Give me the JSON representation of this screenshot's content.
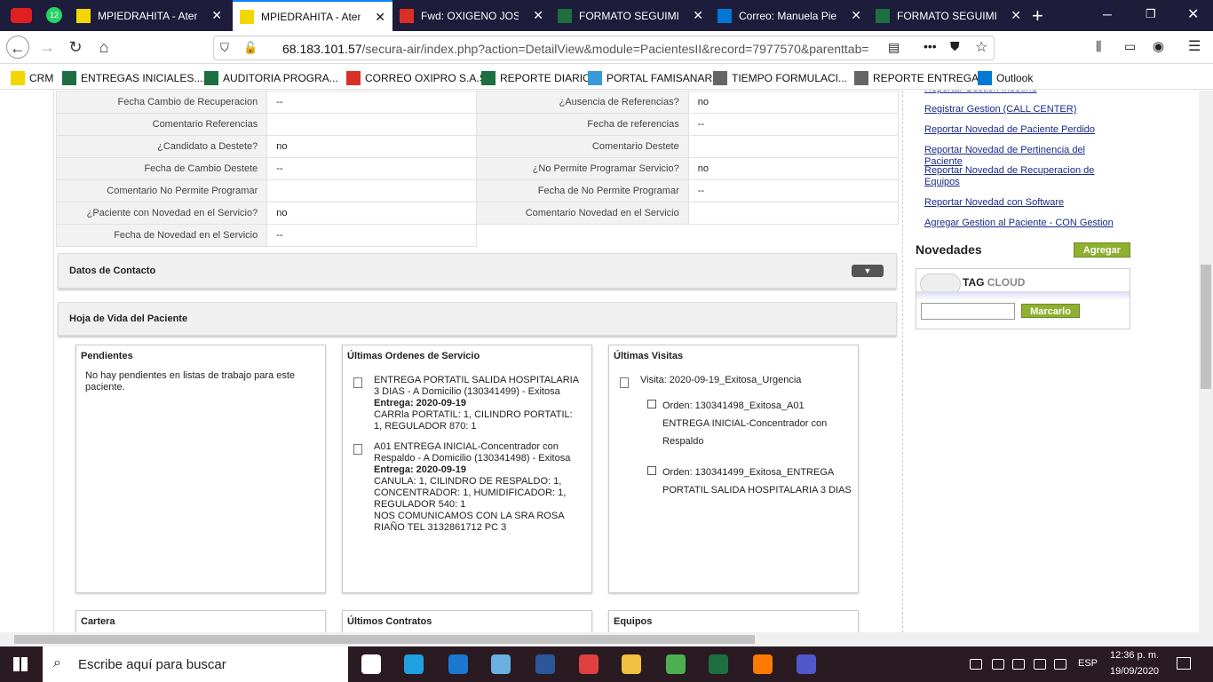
{
  "tabs": [
    {
      "title": "MPIEDRAHITA - Atenc",
      "active": false
    },
    {
      "title": "MPIEDRAHITA - Atenc",
      "active": true
    },
    {
      "title": "Fwd: OXIGENO JOSE P",
      "active": false
    },
    {
      "title": "FORMATO SEGUIMIEN",
      "active": false
    },
    {
      "title": "Correo: Manuela Piedr",
      "active": false
    },
    {
      "title": "FORMATO SEGUIMIEN",
      "active": false
    }
  ],
  "tab_badge": "12",
  "url": {
    "host": "68.183.101.57",
    "path": "/secura-air/index.php?action=DetailView&module=PacientesII&record=7977570&parenttab=Sc"
  },
  "bookmarks": [
    "CRM",
    "ENTREGAS INICIALES....",
    "AUDITORIA PROGRA...",
    "CORREO OXIPRO S.A.S",
    "REPORTE DIARIO",
    "PORTAL FAMISANAR",
    "TIEMPO FORMULACI...",
    "REPORTE ENTREGAS",
    "Outlook"
  ],
  "fields": [
    [
      "Fecha Cambio de Recuperacion",
      "--",
      "¿Ausencia de Referencias?",
      "no"
    ],
    [
      "Comentario Referencias",
      "",
      "Fecha de referencias",
      "--"
    ],
    [
      "¿Candidato a Destete?",
      "no",
      "Comentario Destete",
      ""
    ],
    [
      "Fecha de Cambio Destete",
      "--",
      "¿No Permite Programar Servicio?",
      "no"
    ],
    [
      "Comentario No Permite Programar",
      "",
      "Fecha de No Permite Programar",
      "--"
    ],
    [
      "¿Paciente con Novedad en el Servicio?",
      "no",
      "Comentario Novedad en el Servicio",
      ""
    ],
    [
      "Fecha de Novedad en el Servicio",
      "--",
      "",
      ""
    ]
  ],
  "sections": {
    "contacto": "Datos de Contacto",
    "hoja": "Hoja de Vida del Paciente"
  },
  "pendientes": {
    "title": "Pendientes",
    "text": "No hay pendientes en listas de trabajo para este paciente."
  },
  "ordenes": {
    "title": "Últimas Ordenes de Servicio",
    "items": [
      {
        "desc": "ENTREGA PORTATIL SALIDA HOSPITALARIA 3 DIAS - A Domicilio (130341499) - Exitosa",
        "entrega": "Entrega: 2020-09-19",
        "detail": "CARRla PORTATIL: 1, CILINDRO PORTATIL: 1, REGULADOR 870: 1"
      },
      {
        "desc": "A01 ENTREGA INICIAL-Concentrador con Respaldo - A Domicilio (130341498) - Exitosa",
        "entrega": "Entrega: 2020-09-19",
        "detail": "CANULA: 1, CILINDRO DE RESPALDO: 1, CONCENTRADOR: 1, HUMIDIFICADOR: 1, REGULADOR 540: 1",
        "note": "NOS COMUNICAMOS CON LA SRA ROSA RIAÑO TEL 3132861712 PC 3"
      }
    ]
  },
  "visitas": {
    "title": "Últimas Visitas",
    "visita": "Visita: 2020-09-19_Exitosa_Urgencia",
    "orders": [
      {
        "l1": "Orden: 130341498_Exitosa_A01",
        "l2": "ENTREGA INICIAL-Concentrador con",
        "l3": "Respaldo"
      },
      {
        "l1": "Orden: 130341499_Exitosa_ENTREGA",
        "l2": "PORTATIL SALIDA HOSPITALARIA 3 DIAS",
        "l3": ""
      }
    ]
  },
  "bottom_boxes": [
    "Cartera",
    "Últimos Contratos",
    "Equipos"
  ],
  "side_links": [
    "Reportar Gestion Inbound",
    "Registrar Gestion (CALL CENTER)",
    "Reportar Novedad de Paciente Perdido",
    "Reportar Novedad de Pertinencia del Paciente",
    "Reportar Novedad de Recuperacion de Equipos",
    "Reportar Novedad con Software",
    "Agregar Gestion al Paciente - CON Gestion"
  ],
  "novedades": {
    "title": "Novedades",
    "button": "Agregar"
  },
  "tagcloud": {
    "title_a": "TAG",
    "title_b": "CLOUD",
    "button": "Marcarlo"
  },
  "taskbar": {
    "search": "Escribe aquí para buscar",
    "lang": "ESP",
    "time": "12:36 p. m.",
    "date": "19/09/2020",
    "notif": "1"
  },
  "colors": {
    "tabbar": "#1d1c3a",
    "green_btn": "#8fb030",
    "taskbar": "#2a1a22"
  }
}
